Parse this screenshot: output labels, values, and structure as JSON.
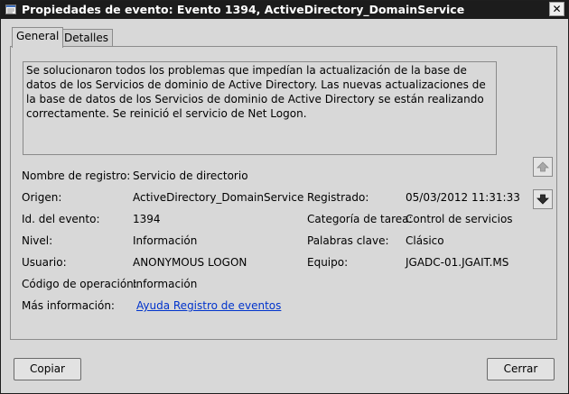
{
  "window": {
    "title": "Propiedades de evento: Evento 1394, ActiveDirectory_DomainService",
    "close_label": "✕"
  },
  "tabs": [
    {
      "label": "General",
      "active": true
    },
    {
      "label": "Detalles",
      "active": false
    }
  ],
  "description": "Se solucionaron todos los problemas que impedían la actualización de la base de datos de los Servicios de dominio de Active Directory. Las nuevas actualizaciones de la base de datos de los Servicios de dominio de Active Directory se están realizando correctamente. Se reinició el servicio de Net Logon.",
  "fields": {
    "log_name_label": "Nombre de registro:",
    "log_name_value": "Servicio de directorio",
    "source_label": "Origen:",
    "source_value": "ActiveDirectory_DomainService",
    "logged_label": "Registrado:",
    "logged_value": "05/03/2012 11:31:33",
    "event_id_label": "Id. del evento:",
    "event_id_value": "1394",
    "task_category_label": "Categoría de tarea:",
    "task_category_value": "Control de servicios",
    "level_label": "Nivel:",
    "level_value": "Información",
    "keywords_label": "Palabras clave:",
    "keywords_value": "Clásico",
    "user_label": "Usuario:",
    "user_value": "ANONYMOUS LOGON",
    "computer_label": "Equipo:",
    "computer_value": "JGADC-01.JGAIT.MS",
    "opcode_label": "Código de operación:",
    "opcode_value": "Información",
    "more_info_label": "Más información:",
    "more_info_link": "Ayuda Registro de eventos"
  },
  "buttons": {
    "copy_label": "Copiar",
    "close_label": "Cerrar"
  },
  "icons": {
    "title": "event-viewer-icon",
    "up": "arrow-up-icon",
    "down": "arrow-down-icon"
  }
}
